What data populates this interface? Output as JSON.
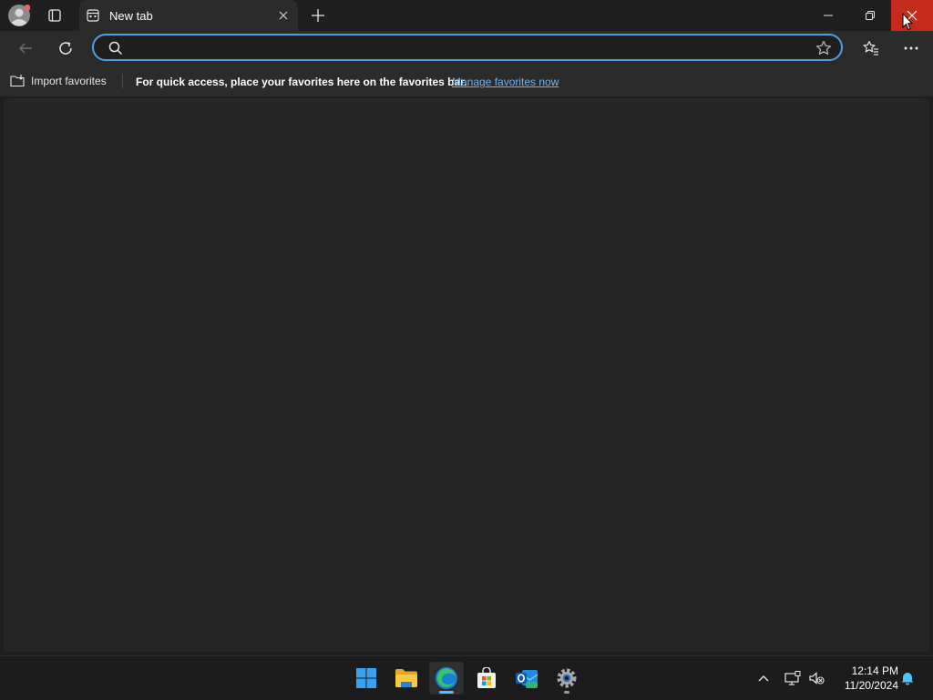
{
  "tab": {
    "title": "New tab"
  },
  "address_bar": {
    "value": "",
    "placeholder": ""
  },
  "favorites_bar": {
    "import_label": "Import favorites",
    "message": "For quick access, place your favorites here on the favorites bar.",
    "link": "Manage favorites now"
  },
  "taskbar": {
    "apps": [
      "start-icon",
      "file-explorer-icon",
      "edge-icon",
      "microsoft-store-icon",
      "outlook-new-icon",
      "settings-icon"
    ],
    "time": "12:14 PM",
    "date": "11/20/2024"
  },
  "colors": {
    "accent": "#4c9fe6",
    "close_hover": "#c42b1c",
    "link": "#6cb4f0"
  }
}
